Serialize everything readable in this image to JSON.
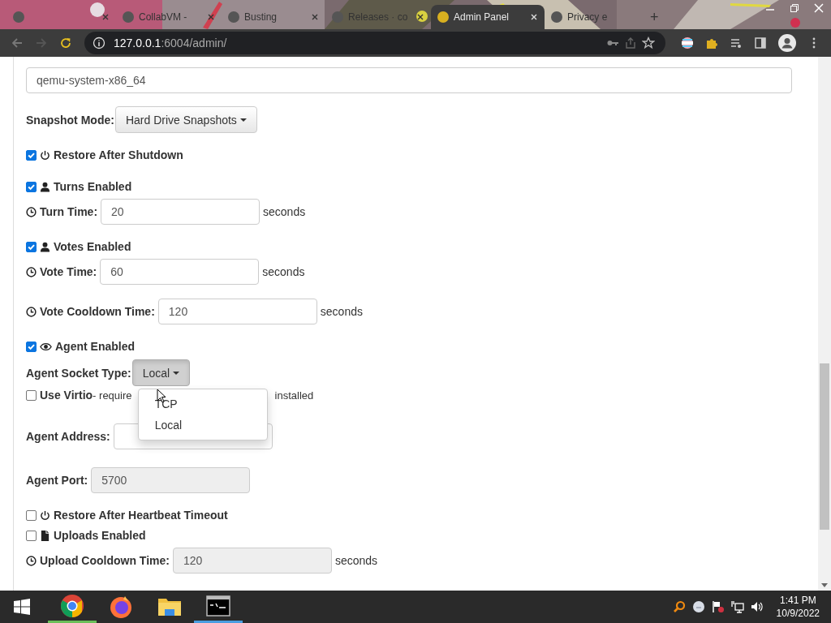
{
  "browser": {
    "tabs": [
      {
        "selected": false
      },
      {
        "title": "CollabVM -",
        "selected": false
      },
      {
        "title": "Busting",
        "selected": false
      },
      {
        "title": "Releases · co",
        "selected": false
      },
      {
        "title": "Admin Panel",
        "selected": true
      },
      {
        "title": "Privacy e",
        "selected": false
      }
    ],
    "new_tab": "+",
    "address": {
      "host": "127.0.0.1",
      "path": ":6004/admin/"
    }
  },
  "form": {
    "rows": [
      {
        "kind": "text",
        "value": "qemu-system-x86_64"
      },
      {
        "kind": "select",
        "label": "Snapshot Mode:",
        "value": "Hard Drive Snapshots",
        "open": false
      },
      {
        "kind": "checkbox",
        "label": "Restore After Shutdown",
        "checked": true
      },
      {
        "kind": "checkbox",
        "label": "Turns Enabled",
        "checked": true
      },
      {
        "kind": "number",
        "label": "Turn Time:",
        "value": "20",
        "unit": "seconds",
        "disabled": false
      },
      {
        "kind": "checkbox",
        "label": "Votes Enabled",
        "checked": true
      },
      {
        "kind": "number",
        "label": "Vote Time:",
        "value": "60",
        "unit": "seconds",
        "disabled": false
      },
      {
        "kind": "number",
        "label": "Vote Cooldown Time:",
        "value": "120",
        "unit": "seconds",
        "disabled": false
      },
      {
        "kind": "checkbox",
        "label": "Agent Enabled",
        "checked": true
      },
      {
        "kind": "select",
        "label": "Agent Socket Type:",
        "value": "Local",
        "open": true,
        "options": [
          "TCP",
          "Local"
        ]
      },
      {
        "kind": "virtio",
        "label": "Use Virtio",
        "note_start": "- require",
        "note_end": "installed",
        "checked": false
      },
      {
        "kind": "number",
        "label": "Agent Address:",
        "disabled": false
      },
      {
        "kind": "number",
        "label": "Agent Port:",
        "value": "5700",
        "disabled": true
      },
      {
        "kind": "checkbox",
        "label": "Restore After Heartbeat Timeout",
        "checked": false
      },
      {
        "kind": "checkbox",
        "label": "Uploads Enabled",
        "checked": false
      },
      {
        "kind": "number",
        "label": "Upload Cooldown Time:",
        "value": "120",
        "unit": "seconds",
        "disabled": true
      }
    ]
  },
  "taskbar": {
    "time": "1:41 PM",
    "date": "10/9/2022"
  }
}
